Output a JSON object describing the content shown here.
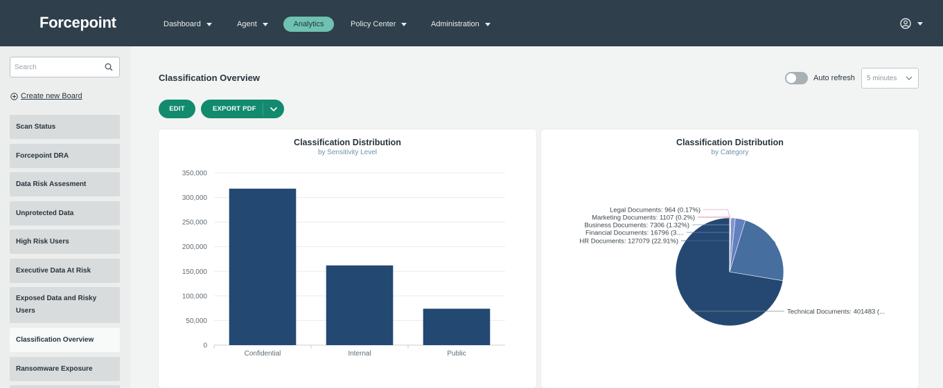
{
  "app": {
    "logo": "Forcepoint"
  },
  "nav": {
    "items": [
      {
        "label": "Dashboard",
        "has_dropdown": true
      },
      {
        "label": "Agent",
        "has_dropdown": true
      },
      {
        "label": "Analytics",
        "active": true
      },
      {
        "label": "Policy Center",
        "has_dropdown": true
      },
      {
        "label": "Administration",
        "has_dropdown": true
      }
    ],
    "user_icon": "user-circle-icon"
  },
  "sidebar": {
    "search_placeholder": "Search",
    "create_board_label": "Create new Board",
    "items": [
      {
        "label": "Scan Status"
      },
      {
        "label": "Forcepoint DRA"
      },
      {
        "label": "Data Risk Assesment"
      },
      {
        "label": "Unprotected Data"
      },
      {
        "label": "High Risk Users"
      },
      {
        "label": "Executive Data At Risk"
      },
      {
        "label": "Exposed Data and Risky Users"
      },
      {
        "label": "Classification Overview",
        "active": true
      },
      {
        "label": "Ransomware Exposure"
      }
    ]
  },
  "header": {
    "title": "Classification Overview",
    "auto_refresh_label": "Auto refresh",
    "auto_refresh_on": false,
    "refresh_interval": "5 minutes",
    "edit_label": "EDIT",
    "export_label": "EXPORT PDF"
  },
  "colors": {
    "topbar": "#2f3f4b",
    "accent_button": "#128a6e",
    "active_nav": "#6fc1b1",
    "bar": "#234872"
  },
  "chart_data": [
    {
      "type": "bar",
      "title": "Classification Distribution",
      "subtitle": "by Sensitivity Level",
      "categories": [
        "Confidential",
        "Internal",
        "Public"
      ],
      "values": [
        318000,
        162000,
        74000
      ],
      "ylim": [
        0,
        350000
      ],
      "yticks": [
        "0",
        "50,000",
        "100,000",
        "150,000",
        "200,000",
        "250,000",
        "300,000",
        "350,000"
      ],
      "grid": true
    },
    {
      "type": "pie",
      "title": "Classification Distribution",
      "subtitle": "by Category",
      "slices": [
        {
          "label": "Technical Documents: 401483 (...",
          "value": 401483,
          "color": "#254872"
        },
        {
          "label": "HR Documents: 127079 (22.91%)",
          "value": 127079,
          "color": "#466e9f"
        },
        {
          "label": "Financial Documents: 16796 (3....",
          "value": 16796,
          "color": "#6280bd"
        },
        {
          "label": "Business Documents: 7306 (1.32%)",
          "value": 7306,
          "color": "#7f96cf"
        },
        {
          "label": "Marketing Documents: 1107 (0.2%)",
          "value": 1107,
          "color": "#d46a8a"
        },
        {
          "label": "Legal Documents: 964 (0.17%)",
          "value": 964,
          "color": "#e6a3b8"
        }
      ]
    }
  ]
}
